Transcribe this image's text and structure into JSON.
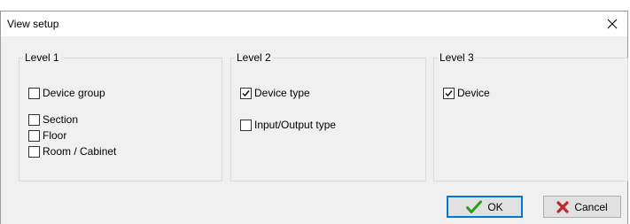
{
  "dialog": {
    "title": "View setup"
  },
  "groups": [
    {
      "legend": "Level 1",
      "items": [
        {
          "label": "Device group",
          "checked": false
        },
        {
          "label": "Section",
          "checked": false
        },
        {
          "label": "Floor",
          "checked": false
        },
        {
          "label": "Room / Cabinet",
          "checked": false
        }
      ]
    },
    {
      "legend": "Level 2",
      "items": [
        {
          "label": "Device type",
          "checked": true
        },
        {
          "label": "Input/Output type",
          "checked": false
        }
      ]
    },
    {
      "legend": "Level 3",
      "items": [
        {
          "label": "Device",
          "checked": true
        }
      ]
    }
  ],
  "buttons": {
    "ok_label": "OK",
    "cancel_label": "Cancel"
  },
  "colors": {
    "focus_border": "#0078d7",
    "ok_icon": "#2e9b1f",
    "cancel_icon": "#c0262d"
  },
  "icons": {
    "close": "close-icon",
    "ok": "checkmark-icon",
    "cancel": "cross-icon"
  }
}
